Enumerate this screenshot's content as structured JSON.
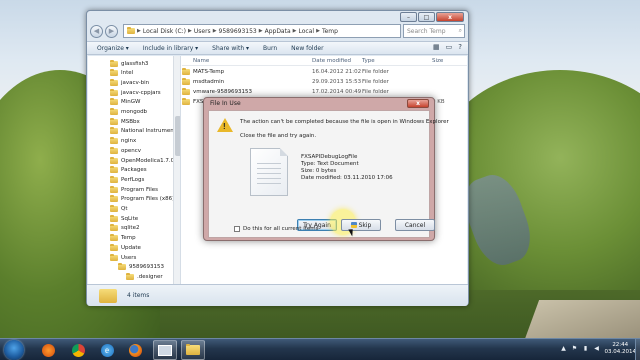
{
  "explorer": {
    "window_controls": {
      "minimize": "–",
      "maximize": "□",
      "close": "x"
    },
    "nav": {
      "back": "◀",
      "forward": "▶"
    },
    "breadcrumb": [
      "Local Disk (C:)",
      "Users",
      "9589693153",
      "AppData",
      "Local",
      "Temp"
    ],
    "search_placeholder": "Search Temp",
    "toolbar": [
      "Organize ▾",
      "Include in library ▾",
      "Share with ▾",
      "Burn",
      "New folder"
    ],
    "columns": {
      "name": "Name",
      "date": "Date modified",
      "type": "Type",
      "size": "Size"
    },
    "files": [
      {
        "name": "MATS-Temp",
        "date": "16.04.2012 21:02",
        "type": "File folder",
        "size": ""
      },
      {
        "name": "msdtadmin",
        "date": "29.09.2013 15:53",
        "type": "File folder",
        "size": ""
      },
      {
        "name": "vmware-9589693153",
        "date": "17.02.2014 00:49",
        "type": "File folder",
        "size": ""
      },
      {
        "name": "FXSAPIDebugLogFile",
        "date": "",
        "type": "",
        "size": "0 KB"
      }
    ],
    "nav_tree": [
      {
        "label": "glassfish3",
        "indent": 0
      },
      {
        "label": "Intel",
        "indent": 0
      },
      {
        "label": "javacv-bin",
        "indent": 0
      },
      {
        "label": "javacv-cppjars",
        "indent": 0
      },
      {
        "label": "MinGW",
        "indent": 0
      },
      {
        "label": "mongodb",
        "indent": 0
      },
      {
        "label": "MSBbx",
        "indent": 0
      },
      {
        "label": "National Instruments",
        "indent": 0
      },
      {
        "label": "nginx",
        "indent": 0
      },
      {
        "label": "opencv",
        "indent": 0
      },
      {
        "label": "OpenModelica1.7.0",
        "indent": 0
      },
      {
        "label": "Packages",
        "indent": 0
      },
      {
        "label": "PerfLogs",
        "indent": 0
      },
      {
        "label": "Program Files",
        "indent": 0
      },
      {
        "label": "Program Files (x86)",
        "indent": 0
      },
      {
        "label": "Qt",
        "indent": 0
      },
      {
        "label": "SqLite",
        "indent": 0
      },
      {
        "label": "sqlite2",
        "indent": 0
      },
      {
        "label": "Temp",
        "indent": 0
      },
      {
        "label": "Update",
        "indent": 0
      },
      {
        "label": "Users",
        "indent": 0
      },
      {
        "label": "9589693153",
        "indent": 1
      },
      {
        "label": ".designer",
        "indent": 2
      }
    ],
    "details": {
      "count": "4 items"
    }
  },
  "dialog": {
    "title": "File In Use",
    "close": "x",
    "message": "The action can't be completed because the file is open in Windows Explorer",
    "hint": "Close the file and try again.",
    "file_info": [
      "FXSAPIDebugLogFile",
      "Type: Text Document",
      "Size: 0 bytes",
      "Date modified: 03.11.2010 17:06"
    ],
    "buttons": {
      "try_again": "Try Again",
      "skip": "Skip",
      "cancel": "Cancel"
    },
    "checkbox_label": "Do this for all current items"
  },
  "taskbar": {
    "apps": [
      "media-player-icon",
      "chrome-icon",
      "ie-icon",
      "firefox-icon",
      "window-icon",
      "explorer-icon"
    ],
    "clock_time": "22:44",
    "clock_date": "03.04.2014"
  }
}
